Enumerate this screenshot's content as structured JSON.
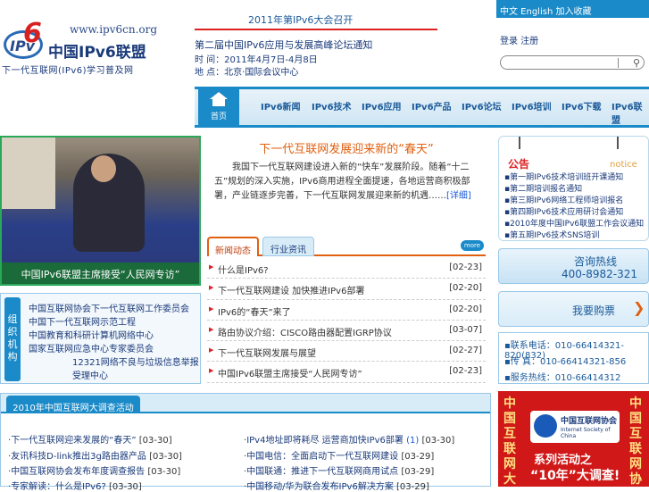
{
  "logo": {
    "url": "www.ipv6cn.org",
    "badge": "IPv",
    "six": "6",
    "name": "中国IPv6联盟",
    "slogan": "下一代互联网(IPv6)学习普及网"
  },
  "top_news": {
    "title": "2011年第IPv6大会召开",
    "headline": "第二届中国IPv6应用与发展高峰论坛通知",
    "date": "时 间：2011年4月7日-4月8日",
    "place": "地 点：北京·国际会议中心"
  },
  "top_right": {
    "lang": "中文 English 加入收藏",
    "login": "登录  注册",
    "search_placeholder": "",
    "search_icon": "search-icon"
  },
  "nav": {
    "home_label": "首页",
    "items": [
      "IPv6新闻",
      "IPv6技术",
      "IPv6应用",
      "IPv6产品",
      "IPv6论坛",
      "IPv6培训",
      "IPv6下载",
      "IPv6联盟"
    ]
  },
  "photo": {
    "caption": "中国IPv6联盟主席接受“人民网专访”"
  },
  "feature": {
    "title": "下一代互联网发展迎来新的“春天”",
    "body": "我国下一代互联网建设进入新的“快车”发展阶段。随着“十二五”规划的深入实施，IPv6商用进程全面提速，各地运营商积极部署，产业链逐步完善，下一代互联网发展迎来新的机遇……",
    "more": "[详细]"
  },
  "tabs": {
    "active": "新闻动态",
    "inactive": "行业资讯",
    "more": "more"
  },
  "news": [
    {
      "title": "什么是IPv6?",
      "date": "[02-23]"
    },
    {
      "title": "下一代互联网建设 加快推进IPv6部署",
      "date": "[02-20]"
    },
    {
      "title": "IPv6的“春天”来了",
      "date": "[02-20]"
    },
    {
      "title": "路由协议介绍：CISCO路由器配置IGRP协议",
      "date": "[03-07]"
    },
    {
      "title": "下一代互联网发展与展望",
      "date": "[02-27]"
    },
    {
      "title": "中国IPv6联盟主席接受“人民网专访”",
      "date": "[02-23]"
    }
  ],
  "orgs": {
    "label": "组织机构",
    "lines": [
      "中国互联网协会下一代互联网工作委员会",
      "中国下一代互联网示范工程",
      "中国教育和科研计算机网络中心",
      "国家互联网应急中心专家委员会",
      "12321网络不良与垃圾信息举报",
      "受理中心"
    ]
  },
  "notice": {
    "heading": "公告",
    "eng": "notice",
    "items": [
      "第一期IPv6技术培训班开课通知",
      "第二期培训报名通知",
      "第三期IPv6网络工程师培训报名",
      "第四期IPv6技术应用研讨会通知",
      "2010年度中国IPv6联盟工作会议通知",
      "第五期IPv6技术SNS培训"
    ]
  },
  "hotline": {
    "title": "咨询热线",
    "number": "400-8982-321"
  },
  "buy": {
    "label": "我要购票",
    "arrow": "❯"
  },
  "contacts": [
    "联系电话：010-66414321-820(832)",
    "传    真：010-66414321-856",
    "服务热线：010-66414312"
  ],
  "bottom": {
    "tab": "2010年中国互联网大调查活动",
    "left": [
      {
        "title": "下一代互联网迎来发展的“春天”",
        "date": "[03-30]"
      },
      {
        "title": "友讯科技D-link推出3g路由器产品",
        "date": "[03-30]"
      },
      {
        "title": "中国互联网协会发布年度调查报告",
        "date": "[03-30]"
      },
      {
        "title": "专家解读：什么是IPv6?",
        "date": "[03-30]"
      }
    ],
    "right": [
      {
        "title": "IPv4地址即将耗尽 运营商加快IPv6部署",
        "num": "(1)",
        "date": "[03-30]"
      },
      {
        "title": "中国电信：全面启动下一代互联网建设",
        "num": "",
        "date": "[03-29]"
      },
      {
        "title": "中国联通：推进下一代互联网商用试点",
        "num": "",
        "date": "[03-29]"
      },
      {
        "title": "中国移动/华为联合发布IPv6解决方案",
        "num": "",
        "date": "[03-29]"
      }
    ]
  },
  "ad": {
    "left_vertical": "中国互联网大",
    "right_vertical": "中国互联网协",
    "org_cn": "中国互联网协会",
    "org_en": "Internet Society of China",
    "line1": "系列活动之",
    "line2": "“10年”大调查!"
  },
  "colors": {
    "accent_blue": "#1a8ac8",
    "accent_red": "#d22222",
    "accent_orange": "#e06010",
    "green_border": "#2aa85a"
  }
}
